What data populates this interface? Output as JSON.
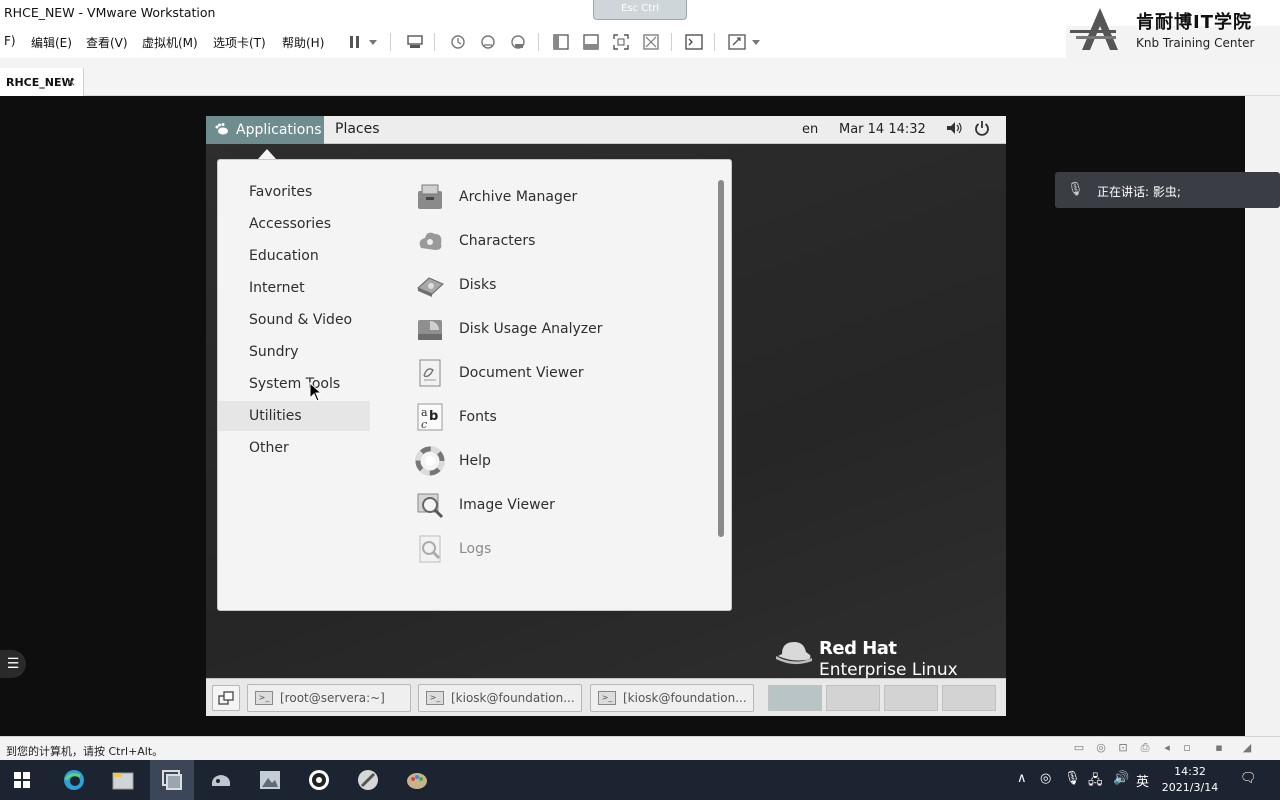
{
  "window": {
    "title": "RHCE_NEW - VMware Workstation",
    "shortcut_chip": "Esc Ctrl"
  },
  "logo": {
    "cn": "肯耐博IT学院",
    "en": "Knb Training Center"
  },
  "menubar": {
    "items": [
      "F)",
      "编辑(E)",
      "查看(V)",
      "虚拟机(M)",
      "选项卡(T)",
      "帮助(H)"
    ]
  },
  "toolbar": {
    "icons": [
      "pause-icon",
      "dropdown-icon",
      "send-keys-icon",
      "snapshot-icon",
      "revert-snapshot-icon",
      "snapshot-manager-icon",
      "sidebar-icon",
      "thumbnail-icon",
      "fullscreen-icon",
      "unity-icon",
      "console-icon",
      "stretch-icon",
      "dropdown-icon"
    ]
  },
  "tab": {
    "label": "RHCE_NEW",
    "close": "×"
  },
  "speaking": {
    "text": "正在讲话: 影虫;"
  },
  "statusbar": {
    "text": "到您的计算机，请按 Ctrl+Alt。"
  },
  "guest": {
    "topbar": {
      "applications": "Applications",
      "places": "Places",
      "lang": "en",
      "datetime": "Mar 14  14:32"
    },
    "categories": [
      {
        "label": "Favorites"
      },
      {
        "label": "Accessories"
      },
      {
        "label": "Education"
      },
      {
        "label": "Internet"
      },
      {
        "label": "Sound & Video"
      },
      {
        "label": "Sundry"
      },
      {
        "label": "System Tools"
      },
      {
        "label": "Utilities"
      },
      {
        "label": "Other"
      }
    ],
    "hovered_category": "Utilities",
    "apps": [
      {
        "label": "Archive Manager",
        "icon": "archive-icon"
      },
      {
        "label": "Characters",
        "icon": "characters-icon"
      },
      {
        "label": "Disks",
        "icon": "disks-icon"
      },
      {
        "label": "Disk Usage Analyzer",
        "icon": "disk-usage-icon"
      },
      {
        "label": "Document Viewer",
        "icon": "document-viewer-icon"
      },
      {
        "label": "Fonts",
        "icon": "fonts-icon"
      },
      {
        "label": "Help",
        "icon": "help-icon"
      },
      {
        "label": "Image Viewer",
        "icon": "image-viewer-icon"
      },
      {
        "label": "Logs",
        "icon": "logs-icon"
      }
    ],
    "brand": {
      "name": "Red Hat",
      "product": "Enterprise Linux"
    },
    "taskbar": {
      "windows": [
        {
          "label": "[root@servera:~]"
        },
        {
          "label": "[kiosk@foundation..."
        },
        {
          "label": "[kiosk@foundation..."
        }
      ]
    }
  },
  "taskbar": {
    "clock_time": "14:32",
    "clock_date": "2021/3/14",
    "ime": "英"
  },
  "colors": {
    "gnome_accent": "#6f8d8f",
    "guest_background": "#2b2b2b",
    "taskbar": "#1c2431"
  }
}
